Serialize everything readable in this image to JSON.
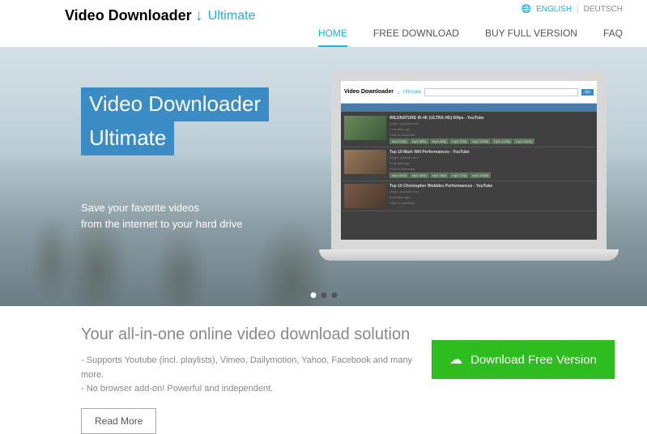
{
  "logo": {
    "main": "Video Downloader",
    "sub": "Ultimate"
  },
  "lang": {
    "english": "ENGLISH",
    "deutsch": "DEUTSCH"
  },
  "nav": {
    "home": "HOME",
    "free": "FREE DOWNLOAD",
    "buy": "BUY FULL VERSION",
    "faq": "FAQ"
  },
  "hero": {
    "title1": "Video Downloader",
    "title2": "Ultimate",
    "sub1": "Save your favorite videos",
    "sub2": "from the internet to your hard drive"
  },
  "app": {
    "logo_main": "Video Downloader",
    "logo_sub": "Ultimate",
    "btn": "Go",
    "videos": [
      {
        "title": "WILDNATURE IN 4K (ULTRA HD) 60fps - YouTube",
        "origin": "Origin: youtube.com",
        "time": "7 minutes ago",
        "click": "Click to download"
      },
      {
        "title": "Top 10 Mark Will Performances - YouTube",
        "origin": "Origin: youtube.com",
        "time": "8 minutes ago",
        "click": "Click to download"
      },
      {
        "title": "Top 10 Christopher Wobbles Performances - YouTube",
        "origin": "Origin: youtube.com",
        "time": "8 minutes ago",
        "click": "Click to download"
      }
    ],
    "formats": [
      "mp4 240p",
      "mp4 360p",
      "mp4 480p",
      "mp4 720p",
      "mp4 1080p",
      "mp4 1440p",
      "mp4 2160p"
    ]
  },
  "content": {
    "headline": "Your all-in-one online video download solution",
    "feat1": "- Supports Youtube (incl. playlists), Vimeo, Dailymotion, Yahoo, Facebook and many more.",
    "feat2": "- No browser add-on! Powerful and independent.",
    "read_more": "Read More",
    "download": "Download Free Version"
  }
}
